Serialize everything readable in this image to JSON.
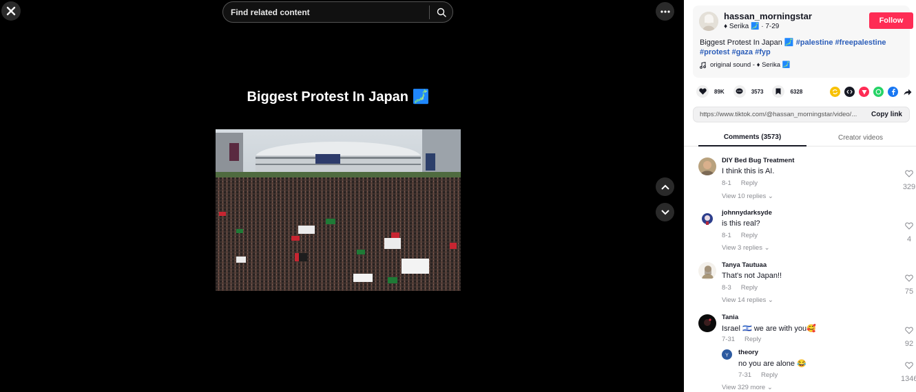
{
  "search": {
    "placeholder": "Find related content"
  },
  "video": {
    "overlay_title": "Biggest Protest In Japan 🗾"
  },
  "author": {
    "username": "hassan_morningstar",
    "display": "♦ Serika 🗾",
    "date": "· 7-29",
    "follow_label": "Follow"
  },
  "description": {
    "text": "Biggest Protest In Japan 🗾",
    "hashtags": [
      "#palestine",
      "#freepalestine",
      "#protest",
      "#gaza",
      "#fyp"
    ]
  },
  "sound": {
    "label": "original sound - ♦ Serika 🗾"
  },
  "stats": {
    "likes": "89K",
    "comments": "3573",
    "saves": "6328"
  },
  "share_icons": [
    "repost-icon",
    "embed-icon",
    "send-icon",
    "whatsapp-icon",
    "facebook-icon",
    "share-arrow-icon"
  ],
  "link": {
    "url": "https://www.tiktok.com/@hassan_morningstar/video/...",
    "copy_label": "Copy link"
  },
  "tabs": {
    "comments": "Comments (3573)",
    "creator": "Creator videos"
  },
  "comments": [
    {
      "user": "DIY Bed Bug Treatment",
      "text": "I think this is AI.",
      "date": "8-1",
      "reply": "Reply",
      "likes": "329",
      "view_replies": "View 10 replies"
    },
    {
      "user": "johnnydarksyde",
      "text": "is this real?",
      "date": "8-1",
      "reply": "Reply",
      "likes": "4",
      "view_replies": "View 3 replies"
    },
    {
      "user": "Tanya Tautuaa",
      "text": "That's not Japan!!",
      "date": "8-3",
      "reply": "Reply",
      "likes": "75",
      "view_replies": "View 14 replies"
    },
    {
      "user": "Tania",
      "text": "Israel 🇮🇱 we are with you🥰",
      "date": "7-31",
      "reply": "Reply",
      "likes": "92",
      "view_replies": "View 329 more"
    }
  ],
  "nested_reply": {
    "user": "theory",
    "text": "no you are alone 😂",
    "date": "7-31",
    "reply": "Reply",
    "likes": "1346"
  },
  "colors": {
    "follow": "#fe2c55",
    "hashtag": "#2b5db9",
    "panel_bg": "#ffffff",
    "video_bg": "#000000"
  }
}
